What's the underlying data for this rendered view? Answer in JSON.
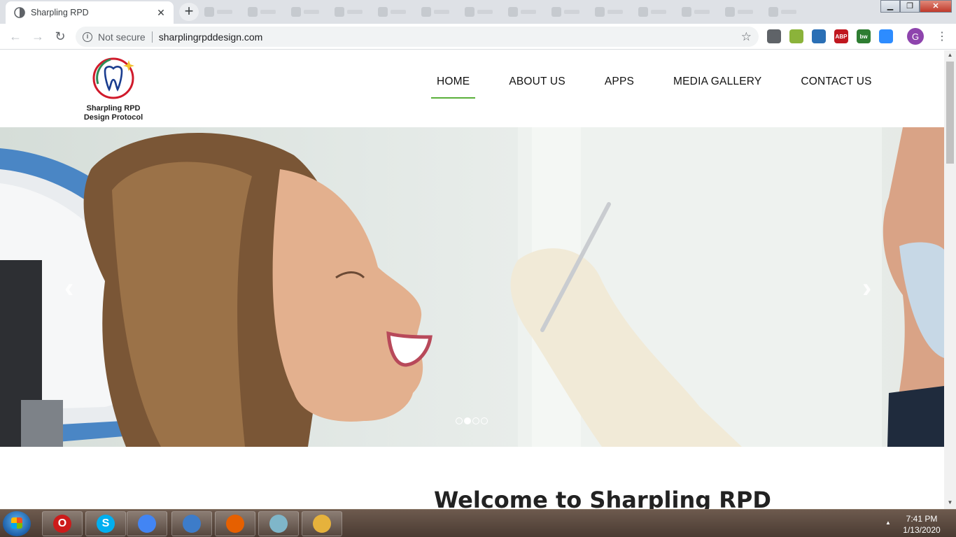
{
  "browser": {
    "tab_title": "Sharpling RPD",
    "new_tab_symbol": "+",
    "security_label": "Not secure",
    "url": "sharplingrpddesign.com",
    "profile_initial": "G",
    "extensions": [
      {
        "name": "camera-icon",
        "label": "",
        "color": "#5f6368"
      },
      {
        "name": "extension-icon",
        "label": "",
        "color": "#8bb33a"
      },
      {
        "name": "download-icon",
        "label": "",
        "color": "#2a6fb5"
      },
      {
        "name": "adblock-icon",
        "label": "ABP",
        "color": "#c0171f"
      },
      {
        "name": "bw-extension-icon",
        "label": "bw",
        "color": "#2e7d32"
      },
      {
        "name": "zoom-icon",
        "label": "",
        "color": "#2d8cff"
      }
    ]
  },
  "site": {
    "logo_text_line1": "Sharpling RPD",
    "logo_text_line2": "Design Protocol",
    "nav": [
      {
        "label": "HOME",
        "active": true
      },
      {
        "label": "ABOUT US",
        "active": false
      },
      {
        "label": "APPS",
        "active": false
      },
      {
        "label": "MEDIA GALLERY",
        "active": false
      },
      {
        "label": "CONTACT US",
        "active": false
      }
    ],
    "carousel": {
      "slide_count": 4,
      "active_slide": 2,
      "prev_symbol": "‹",
      "next_symbol": "›"
    },
    "welcome_heading": "Welcome to Sharpling RPD"
  },
  "taskbar": {
    "apps": [
      {
        "name": "opera-icon",
        "color": "#cc1b1b",
        "label": "O"
      },
      {
        "name": "skype-icon",
        "color": "#00aff0",
        "label": "S"
      },
      {
        "name": "chrome-icon",
        "color": "#4285f4",
        "label": ""
      },
      {
        "name": "mail-icon",
        "color": "#3d7cc9",
        "label": ""
      },
      {
        "name": "firefox-icon",
        "color": "#e66000",
        "label": ""
      },
      {
        "name": "notes-icon",
        "color": "#7fb6c9",
        "label": ""
      },
      {
        "name": "file-explorer-icon",
        "color": "#e6b23c",
        "label": ""
      }
    ],
    "time": "7:41 PM",
    "date": "1/13/2020"
  }
}
